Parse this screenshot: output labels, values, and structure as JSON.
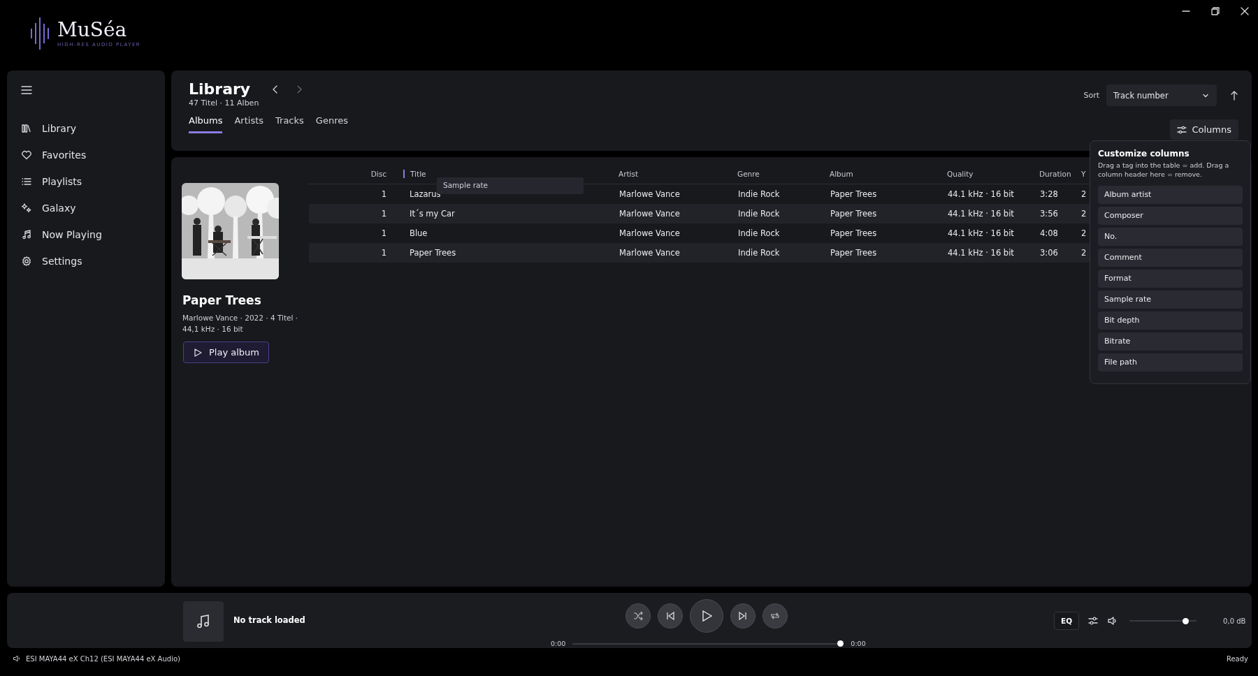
{
  "app": {
    "logo": "MuSéa",
    "tagline": "HIGH-RES AUDIO PLAYER"
  },
  "sidebar": {
    "items": [
      {
        "label": "Library"
      },
      {
        "label": "Favorites"
      },
      {
        "label": "Playlists"
      },
      {
        "label": "Galaxy"
      },
      {
        "label": "Now Playing"
      },
      {
        "label": "Settings"
      }
    ]
  },
  "library": {
    "title": "Library",
    "subtitle": "47 Titel · 11 Alben",
    "tabs": [
      {
        "label": "Albums",
        "selected": true
      },
      {
        "label": "Artists",
        "selected": false
      },
      {
        "label": "Tracks",
        "selected": false
      },
      {
        "label": "Genres",
        "selected": false
      }
    ]
  },
  "sort": {
    "label": "Sort",
    "value": "Track number"
  },
  "columns_button": "Columns",
  "album": {
    "kind": "picture",
    "title": "Paper Trees",
    "meta": "Marlowe Vance · 2022 · 4 Titel · 44,1 kHz · 16 bit",
    "play_button": "Play album"
  },
  "table": {
    "columns": [
      "Disc",
      "Title",
      "Artist",
      "Genre",
      "Album",
      "Quality",
      "Duration",
      "Y"
    ],
    "rows": [
      [
        "1",
        "Lazarus",
        "Marlowe Vance",
        "Indie Rock",
        "Paper Trees",
        "44.1 kHz · 16 bit",
        "3:28",
        "2"
      ],
      [
        "1",
        "It´s my Car",
        "Marlowe Vance",
        "Indie Rock",
        "Paper Trees",
        "44.1 kHz · 16 bit",
        "3:56",
        "2"
      ],
      [
        "1",
        "Blue",
        "Marlowe Vance",
        "Indie Rock",
        "Paper Trees",
        "44.1 kHz · 16 bit",
        "4:08",
        "2"
      ],
      [
        "1",
        "Paper Trees",
        "Marlowe Vance",
        "Indie Rock",
        "Paper Trees",
        "44.1 kHz · 16 bit",
        "3:06",
        "2"
      ]
    ]
  },
  "drag_ghost": "Sample rate",
  "customize": {
    "title": "Customize columns",
    "hint": "Drag a tag into the table = add. Drag a column header here = remove.",
    "tags": [
      "Album artist",
      "Composer",
      "No.",
      "Comment",
      "Format",
      "Sample rate",
      "Bit depth",
      "Bitrate",
      "File path"
    ]
  },
  "player": {
    "track": "No track loaded",
    "elapsed": "0:00",
    "total": "0:00",
    "progress": {
      "level": 1
    },
    "eq": "EQ",
    "volume": {
      "level": 0.87
    },
    "gain": "0,0 dB"
  },
  "status": {
    "device": "ESI MAYA44 eX Ch12 (ESI MAYA44 eX Audio)",
    "state": "Ready"
  }
}
